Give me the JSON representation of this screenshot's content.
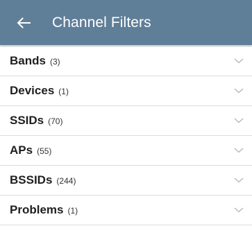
{
  "header": {
    "title": "Channel Filters",
    "bg_color": "#5f7e98",
    "back_icon": "arrow-left-icon"
  },
  "filters": [
    {
      "label": "Bands",
      "count": "(3)"
    },
    {
      "label": "Devices",
      "count": "(1)"
    },
    {
      "label": "SSIDs",
      "count": "(70)"
    },
    {
      "label": "APs",
      "count": "(55)"
    },
    {
      "label": "BSSIDs",
      "count": "(244)"
    },
    {
      "label": "Problems",
      "count": "(1)"
    }
  ],
  "row_icon": "chevron-down-icon"
}
